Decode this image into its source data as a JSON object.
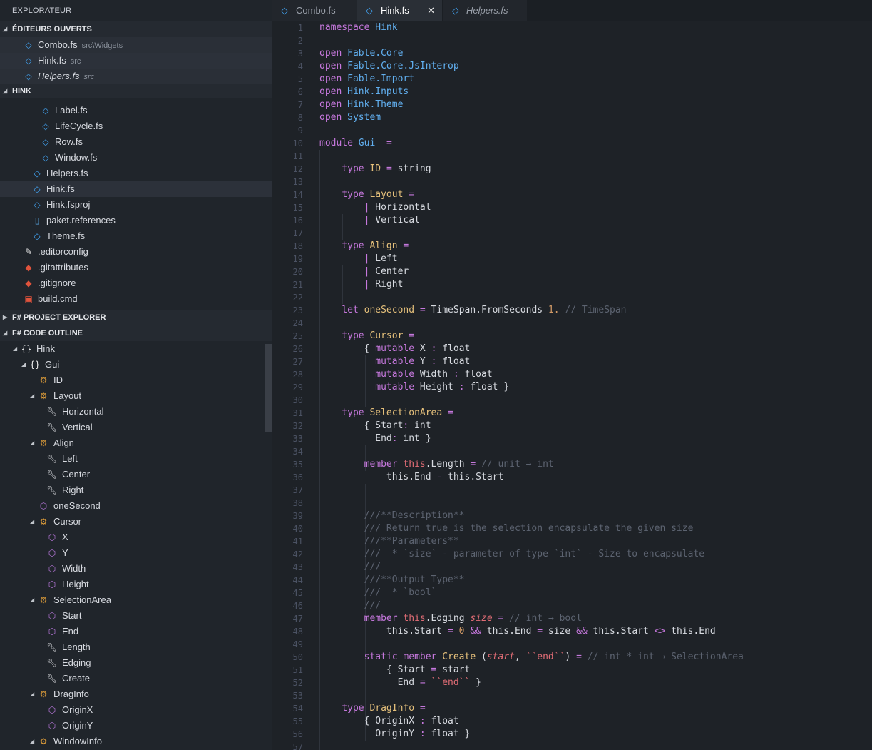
{
  "sidebar": {
    "title": "EXPLORATEUR",
    "open_editors": {
      "header": "ÉDITEURS OUVERTS",
      "items": [
        {
          "name": "Combo.fs",
          "hint": "src\\Widgets"
        },
        {
          "name": "Hink.fs",
          "hint": "src"
        },
        {
          "name": "Helpers.fs",
          "hint": "src"
        }
      ]
    },
    "project": {
      "header": "HINK",
      "items": [
        "Label.fs",
        "LifeCycle.fs",
        "Row.fs",
        "Window.fs",
        "Helpers.fs",
        "Hink.fs",
        "Hink.fsproj",
        "paket.references",
        "Theme.fs",
        ".editorconfig",
        ".gitattributes",
        ".gitignore",
        "build.cmd"
      ]
    },
    "fsharp_project_explorer": {
      "header": "F# PROJECT EXPLORER"
    },
    "code_outline": {
      "header": "F# CODE OUTLINE",
      "items": [
        "Hink",
        "Gui",
        "ID",
        "Layout",
        "Horizontal",
        "Vertical",
        "Align",
        "Left",
        "Center",
        "Right",
        "oneSecond",
        "Cursor",
        "X",
        "Y",
        "Width",
        "Height",
        "SelectionArea",
        "Start",
        "End",
        "Length",
        "Edging",
        "Create",
        "DragInfo",
        "OriginX",
        "OriginY",
        "WindowInfo"
      ]
    }
  },
  "tabs": [
    {
      "label": "Combo.fs",
      "active": false,
      "italic": false
    },
    {
      "label": "Hink.fs",
      "active": true,
      "italic": false,
      "close": "✕"
    },
    {
      "label": "Helpers.fs",
      "active": false,
      "italic": true
    }
  ],
  "editor": {
    "line_numbers": [
      "1",
      "2",
      "3",
      "4",
      "5",
      "6",
      "7",
      "8",
      "9",
      "10",
      "11",
      "12",
      "13",
      "14",
      "15",
      "16",
      "17",
      "18",
      "19",
      "20",
      "21",
      "22",
      "23",
      "24",
      "25",
      "26",
      "27",
      "28",
      "29",
      "30",
      "31",
      "32",
      "33",
      "34",
      "35",
      "36",
      "37",
      "38",
      "39",
      "40",
      "41",
      "42",
      "43",
      "44",
      "45",
      "46",
      "47",
      "48",
      "49",
      "50",
      "51",
      "52",
      "53",
      "54",
      "55",
      "56",
      "57"
    ],
    "lines": [
      [
        [
          "k",
          "namespace "
        ],
        [
          "m",
          "Hink"
        ]
      ],
      [],
      [
        [
          "k",
          "open "
        ],
        [
          "m",
          "Fable.Core"
        ]
      ],
      [
        [
          "k",
          "open "
        ],
        [
          "m",
          "Fable.Core.JsInterop"
        ]
      ],
      [
        [
          "k",
          "open "
        ],
        [
          "m",
          "Fable.Import"
        ]
      ],
      [
        [
          "k",
          "open "
        ],
        [
          "m",
          "Hink.Inputs"
        ]
      ],
      [
        [
          "k",
          "open "
        ],
        [
          "m",
          "Hink.Theme"
        ]
      ],
      [
        [
          "k",
          "open "
        ],
        [
          "m",
          "System"
        ]
      ],
      [],
      [
        [
          "k",
          "module "
        ],
        [
          "m",
          "Gui"
        ],
        [
          "",
          "  "
        ],
        [
          "op",
          "="
        ]
      ],
      [],
      [
        [
          "",
          "    "
        ],
        [
          "k",
          "type "
        ],
        [
          "t",
          "ID"
        ],
        [
          "",
          " "
        ],
        [
          "op",
          "="
        ],
        [
          "",
          " string"
        ]
      ],
      [],
      [
        [
          "",
          "    "
        ],
        [
          "k",
          "type "
        ],
        [
          "t",
          "Layout"
        ],
        [
          "",
          " "
        ],
        [
          "op",
          "="
        ]
      ],
      [
        [
          "",
          "        "
        ],
        [
          "op",
          "| "
        ],
        [
          "",
          "Horizontal"
        ]
      ],
      [
        [
          "",
          "        "
        ],
        [
          "op",
          "| "
        ],
        [
          "",
          "Vertical"
        ]
      ],
      [],
      [
        [
          "",
          "    "
        ],
        [
          "k",
          "type "
        ],
        [
          "t",
          "Align"
        ],
        [
          "",
          " "
        ],
        [
          "op",
          "="
        ]
      ],
      [
        [
          "",
          "        "
        ],
        [
          "op",
          "| "
        ],
        [
          "",
          "Left"
        ]
      ],
      [
        [
          "",
          "        "
        ],
        [
          "op",
          "| "
        ],
        [
          "",
          "Center"
        ]
      ],
      [
        [
          "",
          "        "
        ],
        [
          "op",
          "| "
        ],
        [
          "",
          "Right"
        ]
      ],
      [],
      [
        [
          "",
          "    "
        ],
        [
          "k",
          "let "
        ],
        [
          "t",
          "oneSecond"
        ],
        [
          "",
          " "
        ],
        [
          "op",
          "="
        ],
        [
          "",
          " TimeSpan.FromSeconds "
        ],
        [
          "n",
          "1."
        ],
        [
          "",
          " "
        ],
        [
          "c",
          "// TimeSpan"
        ]
      ],
      [],
      [
        [
          "",
          "    "
        ],
        [
          "k",
          "type "
        ],
        [
          "t",
          "Cursor"
        ],
        [
          "",
          " "
        ],
        [
          "op",
          "="
        ]
      ],
      [
        [
          "",
          "        { "
        ],
        [
          "k",
          "mutable "
        ],
        [
          "",
          "X "
        ],
        [
          "op",
          ":"
        ],
        [
          "",
          " float"
        ]
      ],
      [
        [
          "",
          "          "
        ],
        [
          "k",
          "mutable "
        ],
        [
          "",
          "Y "
        ],
        [
          "op",
          ":"
        ],
        [
          "",
          " float"
        ]
      ],
      [
        [
          "",
          "          "
        ],
        [
          "k",
          "mutable "
        ],
        [
          "",
          "Width "
        ],
        [
          "op",
          ":"
        ],
        [
          "",
          " float"
        ]
      ],
      [
        [
          "",
          "          "
        ],
        [
          "k",
          "mutable "
        ],
        [
          "",
          "Height "
        ],
        [
          "op",
          ":"
        ],
        [
          "",
          " float }"
        ]
      ],
      [],
      [
        [
          "",
          "    "
        ],
        [
          "k",
          "type "
        ],
        [
          "t",
          "SelectionArea"
        ],
        [
          "",
          " "
        ],
        [
          "op",
          "="
        ]
      ],
      [
        [
          "",
          "        { Start"
        ],
        [
          "op",
          ":"
        ],
        [
          "",
          " int"
        ]
      ],
      [
        [
          "",
          "          End"
        ],
        [
          "op",
          ":"
        ],
        [
          "",
          " int }"
        ]
      ],
      [],
      [
        [
          "",
          "        "
        ],
        [
          "k",
          "member "
        ],
        [
          "s",
          "this"
        ],
        [
          "",
          ".Length "
        ],
        [
          "op",
          "="
        ],
        [
          "",
          " "
        ],
        [
          "c",
          "// unit → int"
        ]
      ],
      [
        [
          "",
          "            this.End "
        ],
        [
          "op",
          "-"
        ],
        [
          "",
          " this.Start"
        ]
      ],
      [],
      [],
      [
        [
          "",
          "        "
        ],
        [
          "c",
          "///**Description**"
        ]
      ],
      [
        [
          "",
          "        "
        ],
        [
          "c",
          "/// Return true is the selection encapsulate the given size"
        ]
      ],
      [
        [
          "",
          "        "
        ],
        [
          "c",
          "///**Parameters**"
        ]
      ],
      [
        [
          "",
          "        "
        ],
        [
          "c",
          "///  * `size` - parameter of type `int` - Size to encapsulate"
        ]
      ],
      [
        [
          "",
          "        "
        ],
        [
          "c",
          "///"
        ]
      ],
      [
        [
          "",
          "        "
        ],
        [
          "c",
          "///**Output Type**"
        ]
      ],
      [
        [
          "",
          "        "
        ],
        [
          "c",
          "///  * `bool`"
        ]
      ],
      [
        [
          "",
          "        "
        ],
        [
          "c",
          "///"
        ]
      ],
      [
        [
          "",
          "        "
        ],
        [
          "k",
          "member "
        ],
        [
          "s",
          "this"
        ],
        [
          "",
          ".Edging "
        ],
        [
          "p",
          "size"
        ],
        [
          "",
          " "
        ],
        [
          "op",
          "="
        ],
        [
          "",
          " "
        ],
        [
          "c",
          "// int → bool"
        ]
      ],
      [
        [
          "",
          "            this.Start "
        ],
        [
          "op",
          "="
        ],
        [
          "",
          " "
        ],
        [
          "n",
          "0"
        ],
        [
          "",
          " "
        ],
        [
          "op",
          "&&"
        ],
        [
          "",
          " this.End "
        ],
        [
          "op",
          "="
        ],
        [
          "",
          " size "
        ],
        [
          "op",
          "&&"
        ],
        [
          "",
          " this.Start "
        ],
        [
          "op",
          "<>"
        ],
        [
          "",
          " this.End"
        ]
      ],
      [],
      [
        [
          "",
          "        "
        ],
        [
          "k",
          "static member "
        ],
        [
          "t",
          "Create"
        ],
        [
          "",
          " ("
        ],
        [
          "p",
          "start"
        ],
        [
          ",",
          ", "
        ],
        [
          "s",
          "``end``"
        ],
        [
          "",
          ") "
        ],
        [
          "op",
          "="
        ],
        [
          "",
          " "
        ],
        [
          "c",
          "// int * int → SelectionArea"
        ]
      ],
      [
        [
          "",
          "            { Start "
        ],
        [
          "op",
          "="
        ],
        [
          "",
          " start"
        ]
      ],
      [
        [
          "",
          "              End "
        ],
        [
          "op",
          "="
        ],
        [
          "",
          " "
        ],
        [
          "s",
          "``end``"
        ],
        [
          "",
          " }"
        ]
      ],
      [],
      [
        [
          "",
          "    "
        ],
        [
          "k",
          "type "
        ],
        [
          "t",
          "DragInfo"
        ],
        [
          "",
          " "
        ],
        [
          "op",
          "="
        ]
      ],
      [
        [
          "",
          "        { OriginX "
        ],
        [
          "op",
          ":"
        ],
        [
          "",
          " float"
        ]
      ],
      [
        [
          "",
          "          OriginY "
        ],
        [
          "op",
          ":"
        ],
        [
          "",
          " float }"
        ]
      ],
      []
    ]
  }
}
